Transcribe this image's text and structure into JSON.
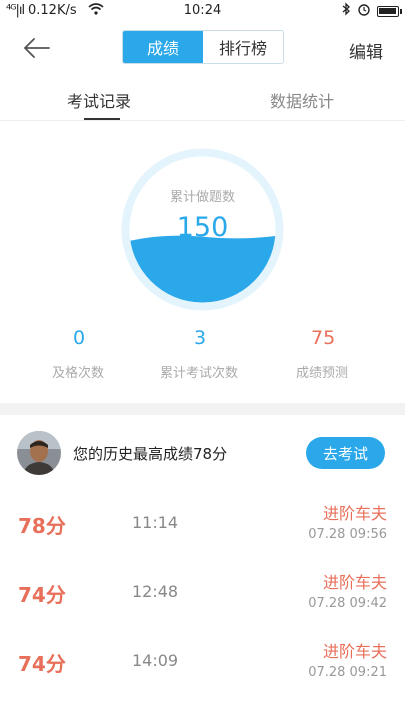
{
  "status": {
    "signal": "⁴ᴳ|ıl",
    "speed": "0.12K/s",
    "time": "10:24"
  },
  "header": {
    "tabs": [
      "成绩",
      "排行榜"
    ],
    "active_tab": "成绩",
    "edit_label": "编辑"
  },
  "sub_tabs": {
    "records": "考试记录",
    "stats": "数据统计"
  },
  "gauge": {
    "label": "累计做题数",
    "value": "150",
    "fill_fraction": 0.45
  },
  "stats": [
    {
      "value": "0",
      "label": "及格次数"
    },
    {
      "value": "3",
      "label": "累计考试次数"
    },
    {
      "value": "75",
      "label": "成绩预测"
    }
  ],
  "best": {
    "text": "您的历史最高成绩78分",
    "button": "去考试"
  },
  "records": [
    {
      "score": "78分",
      "duration": "11:14",
      "level": "进阶车夫",
      "date": "07.28  09:56"
    },
    {
      "score": "74分",
      "duration": "12:48",
      "level": "进阶车夫",
      "date": "07.28  09:42"
    },
    {
      "score": "74分",
      "duration": "14:09",
      "level": "进阶车夫",
      "date": "07.28  09:21"
    }
  ],
  "colors": {
    "accent": "#2aa8ea",
    "score_red": "#e8705a"
  }
}
